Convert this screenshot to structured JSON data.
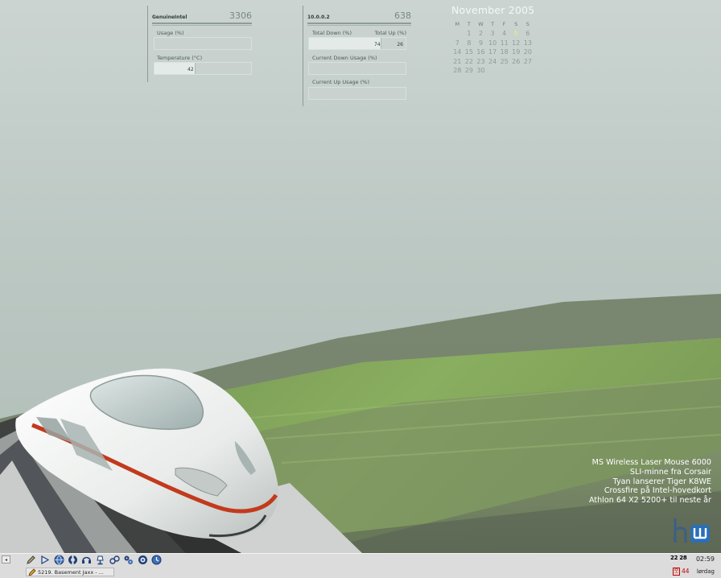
{
  "cpu_widget": {
    "name": "GenuineIntel",
    "value": "3306",
    "usage_label": "Usage (%)",
    "usage_level": 0,
    "temp_label": "Temperature (°C)",
    "temp_value": "42",
    "temp_level": 0.42
  },
  "net_widget": {
    "name": "10.0.0.2",
    "value": "638",
    "total_down_label": "Total Down (%)",
    "total_up_label": "Total Up (%)",
    "total_down_value": "74",
    "total_up_value": "26",
    "total_down_level": 0.74,
    "cur_down_label": "Current Down Usage (%)",
    "cur_down_level": 0,
    "cur_up_label": "Current Up Usage (%)",
    "cur_up_level": 0
  },
  "calendar": {
    "title": "November 2005",
    "weekday_headers": [
      "M",
      "T",
      "W",
      "T",
      "F",
      "S",
      "S"
    ],
    "leading_blanks": 1,
    "days": [
      "1",
      "2",
      "3",
      "4",
      "5",
      "6",
      "7",
      "8",
      "9",
      "10",
      "11",
      "12",
      "13",
      "14",
      "15",
      "16",
      "17",
      "18",
      "19",
      "20",
      "21",
      "22",
      "23",
      "24",
      "25",
      "26",
      "27",
      "28",
      "29",
      "30"
    ],
    "today": "5"
  },
  "news": {
    "items": [
      "MS Wireless Laser Mouse 6000",
      "SLI-minne fra Corsair",
      "Tyan lanserer Tiger K8WE",
      "Crossfire på Intel-hovedkort",
      "Athlon 64 X2 5200+ til neste år"
    ]
  },
  "panel": {
    "collapse_glyph": "◂",
    "task_label": "5219. Basement Jaxx - ...",
    "clock_time": "02:59",
    "clock_day": "lørdag",
    "sys_mem": "22 28",
    "sys_temp": "44",
    "tray_glyph": "空",
    "launchers": [
      "pencil-icon",
      "play-icon",
      "globe-icon",
      "lifebuoy-icon",
      "headset-icon",
      "lamp-icon",
      "network-icon",
      "gears-icon",
      "chat-icon",
      "clock-icon"
    ]
  },
  "colors": {
    "accent_green": "#7fa055",
    "train_stripe": "#c23a1c",
    "today_highlight": "#e8f07a",
    "logo_blue": "#2a6fb8"
  }
}
